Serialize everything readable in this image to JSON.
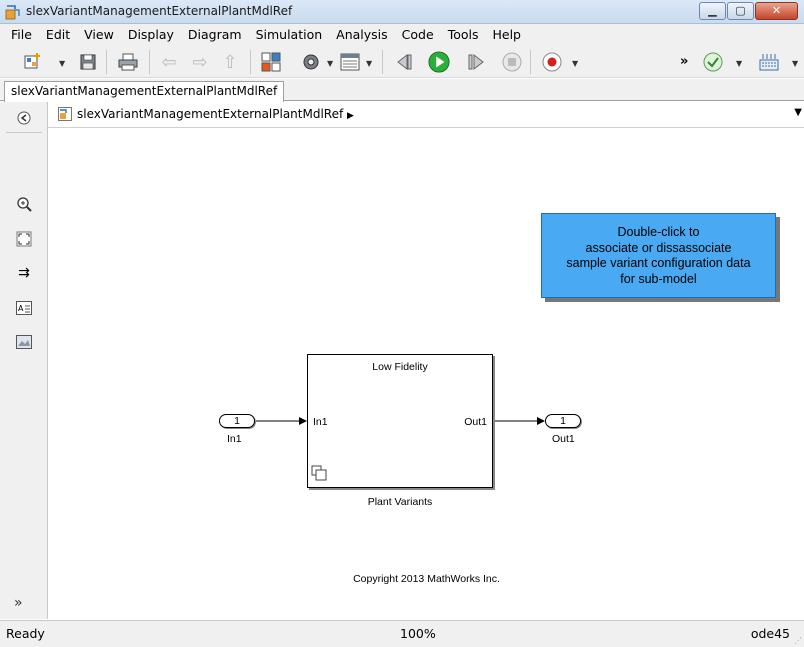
{
  "window": {
    "title": "slexVariantManagementExternalPlantMdlRef",
    "controls": [
      "minimize-icon",
      "maximize-icon",
      "close-icon"
    ]
  },
  "menubar": {
    "items": [
      "File",
      "Edit",
      "View",
      "Display",
      "Diagram",
      "Simulation",
      "Analysis",
      "Code",
      "Tools",
      "Help"
    ]
  },
  "toolbar": {
    "icons": [
      "new-model-icon",
      "save-icon",
      "print-icon",
      "back-icon",
      "forward-icon",
      "up-icon",
      "library-browser-icon",
      "model-config-icon",
      "model-explorer-icon",
      "step-back-icon",
      "run-icon",
      "step-forward-icon",
      "stop-icon",
      "record-icon",
      "overflow-icon",
      "check-icon",
      "build-icon"
    ],
    "overflow_label": "»"
  },
  "tabs": {
    "active": "slexVariantManagementExternalPlantMdlRef"
  },
  "explorer": {
    "path": "slexVariantManagementExternalPlantMdlRef",
    "path_arrow": "▶"
  },
  "palette": {
    "tools": [
      "hide-browser-icon",
      "zoom-icon",
      "fit-view-icon",
      "signal-route-icon",
      "annotation-icon",
      "image-icon"
    ],
    "expand_label": "»"
  },
  "diagram": {
    "annotation": {
      "lines": [
        "Double-click to",
        "associate or dissassociate",
        "sample variant configuration data",
        "for sub-model"
      ]
    },
    "inport": {
      "number": "1",
      "label": "In1"
    },
    "outport": {
      "number": "1",
      "label": "Out1"
    },
    "model_block": {
      "title": "Low Fidelity",
      "in_port": "In1",
      "out_port": "Out1",
      "name": "Plant Variants"
    },
    "copyright": "Copyright 2013 MathWorks Inc.",
    "annotation_color": "#49a9f2"
  },
  "status": {
    "state": "Ready",
    "zoom": "100%",
    "solver": "ode45"
  }
}
